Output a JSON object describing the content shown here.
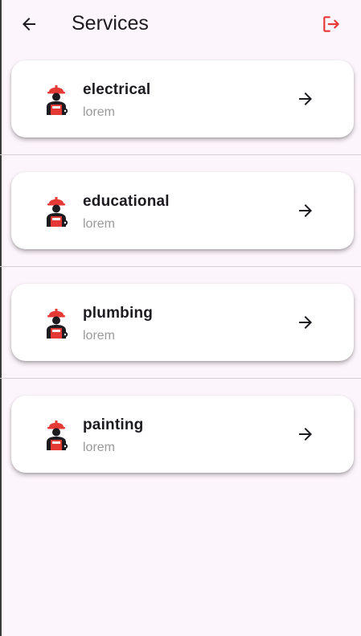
{
  "app_bar": {
    "title": "Services",
    "back_icon": "arrow-left-icon",
    "logout_icon": "logout-icon",
    "logout_color": "#e53935"
  },
  "services": [
    {
      "name": "electrical",
      "subtitle": "lorem",
      "icon": "worker-icon"
    },
    {
      "name": "educational",
      "subtitle": "lorem",
      "icon": "worker-icon"
    },
    {
      "name": "plumbing",
      "subtitle": "lorem",
      "icon": "worker-icon"
    },
    {
      "name": "painting",
      "subtitle": "lorem",
      "icon": "worker-icon"
    }
  ],
  "colors": {
    "background": "#fdf5fc",
    "card": "#ffffff",
    "helmet": "#e53935"
  }
}
